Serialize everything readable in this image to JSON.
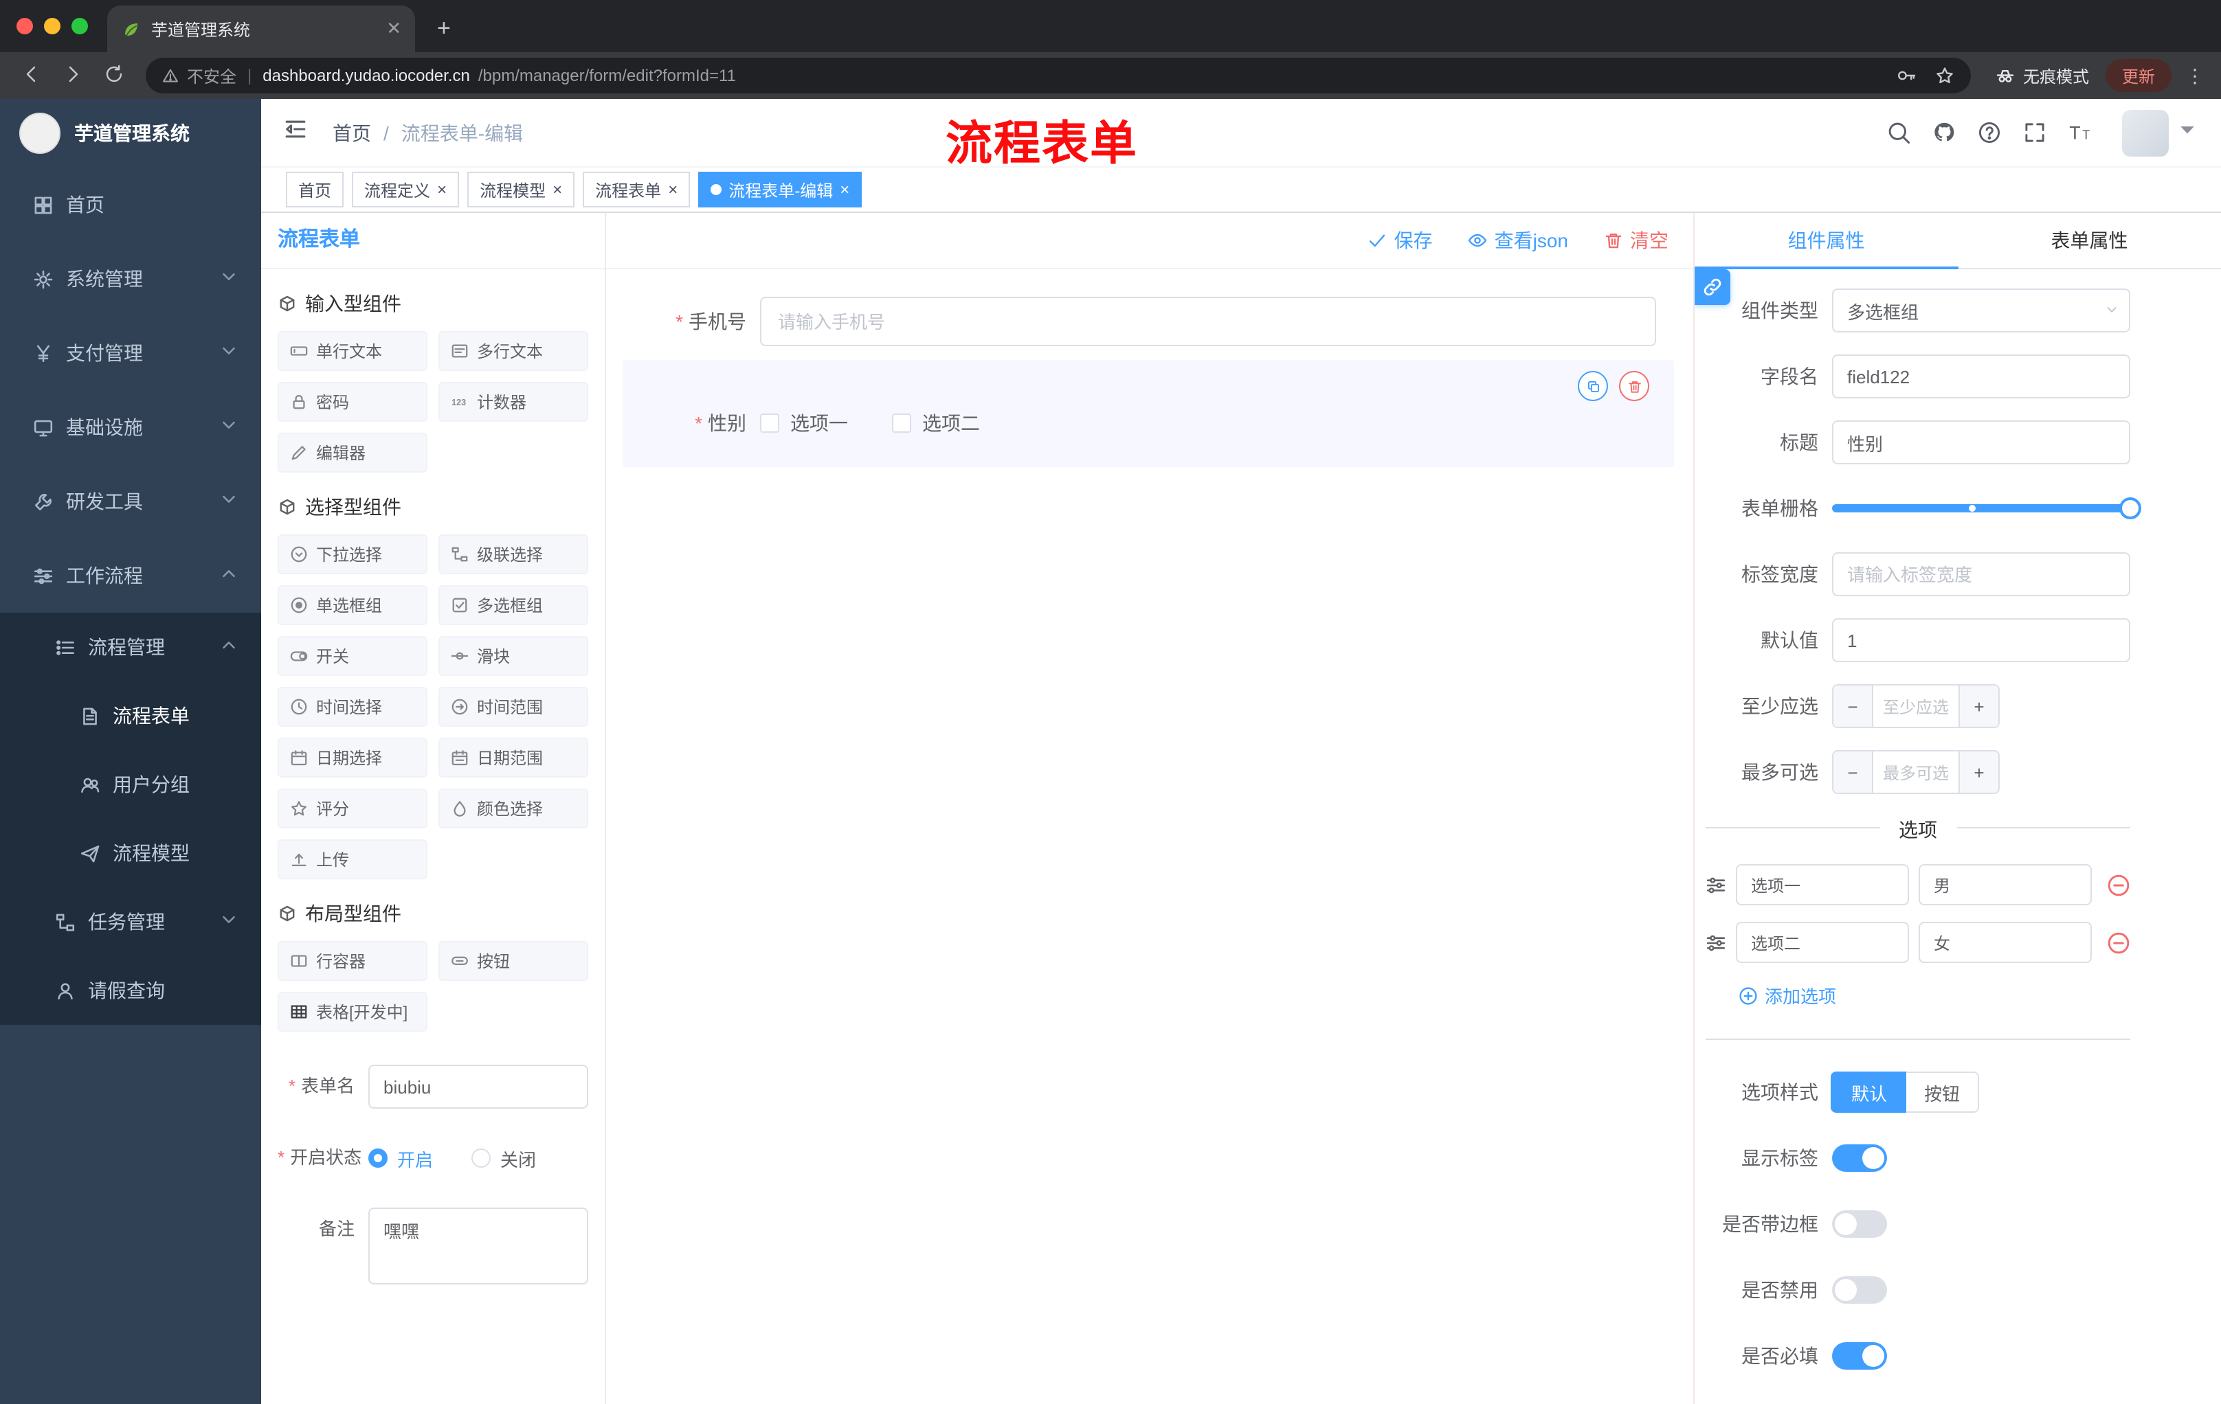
{
  "colors": {
    "primary": "#409eff",
    "danger": "#f56c6c",
    "annotation_red": "#fb0d0d",
    "sidebar_bg": "#304156",
    "sidebar_submenu_bg": "#1f2d3d",
    "active_tag_bg": "#409eff"
  },
  "browser": {
    "tab_title": "芋道管理系统",
    "security_label": "不安全",
    "url_domain": "dashboard.yudao.iocoder.cn",
    "url_path": "/bpm/manager/form/edit?formId=11",
    "incognito_label": "无痕模式",
    "update_button": "更新"
  },
  "sidebar": {
    "logo_title": "芋道管理系统",
    "items": [
      {
        "label": "首页"
      },
      {
        "label": "系统管理"
      },
      {
        "label": "支付管理"
      },
      {
        "label": "基础设施"
      },
      {
        "label": "研发工具"
      },
      {
        "label": "工作流程"
      },
      {
        "label": "流程管理"
      },
      {
        "label": "流程表单"
      },
      {
        "label": "用户分组"
      },
      {
        "label": "流程模型"
      },
      {
        "label": "任务管理"
      },
      {
        "label": "请假查询"
      }
    ]
  },
  "header": {
    "breadcrumb": [
      "首页",
      "流程表单-编辑"
    ],
    "separator": "/",
    "annotation": "流程表单"
  },
  "tags": [
    {
      "label": "首页"
    },
    {
      "label": "流程定义"
    },
    {
      "label": "流程模型"
    },
    {
      "label": "流程表单"
    },
    {
      "label": "流程表单-编辑"
    }
  ],
  "palette": {
    "title": "流程表单",
    "sections": [
      {
        "title": "输入型组件",
        "items": [
          {
            "label": "单行文本"
          },
          {
            "label": "多行文本"
          },
          {
            "label": "密码"
          },
          {
            "label": "计数器"
          },
          {
            "label": "编辑器"
          }
        ]
      },
      {
        "title": "选择型组件",
        "items": [
          {
            "label": "下拉选择"
          },
          {
            "label": "级联选择"
          },
          {
            "label": "单选框组"
          },
          {
            "label": "多选框组"
          },
          {
            "label": "开关"
          },
          {
            "label": "滑块"
          },
          {
            "label": "时间选择"
          },
          {
            "label": "时间范围"
          },
          {
            "label": "日期选择"
          },
          {
            "label": "日期范围"
          },
          {
            "label": "评分"
          },
          {
            "label": "颜色选择"
          },
          {
            "label": "上传"
          }
        ]
      },
      {
        "title": "布局型组件",
        "items": [
          {
            "label": "行容器"
          },
          {
            "label": "按钮"
          },
          {
            "label": "表格[开发中]"
          }
        ]
      }
    ],
    "form": {
      "name_label": "表单名",
      "name_value": "biubiu",
      "status_label": "开启状态",
      "status_on": "开启",
      "status_off": "关闭",
      "status_selected": "开启",
      "remark_label": "备注",
      "remark_value": "嘿嘿"
    }
  },
  "canvas": {
    "actions": {
      "save": "保存",
      "view_json": "查看json",
      "clear": "清空"
    },
    "phone_field": {
      "label": "手机号",
      "required": true,
      "placeholder": "请输入手机号"
    },
    "gender_field": {
      "label": "性别",
      "required": true,
      "options": [
        "选项一",
        "选项二"
      ],
      "checked": [
        false,
        false
      ],
      "selected": true
    }
  },
  "props": {
    "tabs": {
      "component": "组件属性",
      "form": "表单属性",
      "active": "组件属性"
    },
    "component_type": {
      "label": "组件类型",
      "value": "多选框组"
    },
    "field_name": {
      "label": "字段名",
      "value": "field122"
    },
    "title_row": {
      "label": "标题",
      "value": "性别"
    },
    "grid_row": {
      "label": "表单栅格",
      "value_percent": 100,
      "stop_percent": 47
    },
    "label_width": {
      "label": "标签宽度",
      "placeholder": "请输入标签宽度"
    },
    "default_value": {
      "label": "默认值",
      "value": "1"
    },
    "min_select": {
      "label": "至少应选",
      "placeholder": "至少应选"
    },
    "max_select": {
      "label": "最多可选",
      "placeholder": "最多可选"
    },
    "options_title": "选项",
    "options": [
      {
        "name": "选项一",
        "value": "男"
      },
      {
        "name": "选项二",
        "value": "女"
      }
    ],
    "add_option": "添加选项",
    "option_style": {
      "label": "选项样式",
      "choices": [
        "默认",
        "按钮"
      ],
      "active": "默认"
    },
    "switches": [
      {
        "label": "显示标签",
        "on": true
      },
      {
        "label": "是否带边框",
        "on": false
      },
      {
        "label": "是否禁用",
        "on": false
      },
      {
        "label": "是否必填",
        "on": true
      }
    ]
  }
}
